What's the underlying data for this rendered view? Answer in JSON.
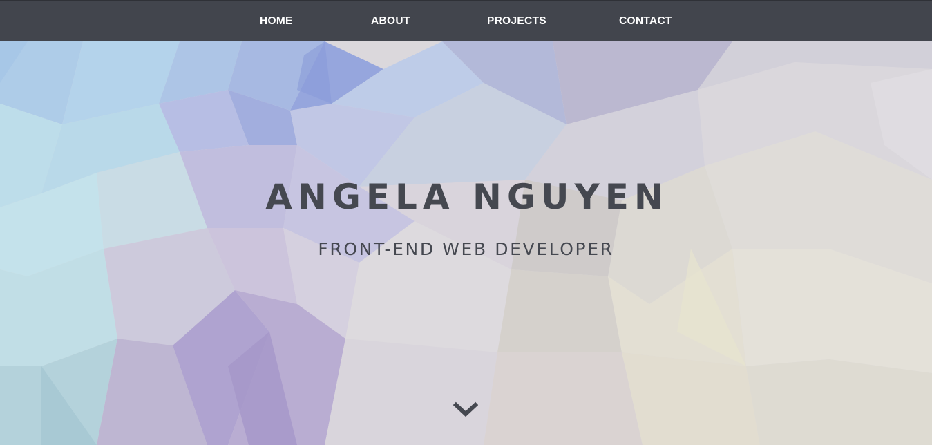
{
  "nav": {
    "items": [
      {
        "label": "HOME"
      },
      {
        "label": "ABOUT"
      },
      {
        "label": "PROJECTS"
      },
      {
        "label": "CONTACT"
      }
    ]
  },
  "hero": {
    "name": "ANGELA NGUYEN",
    "tagline": "FRONT-END WEB DEVELOPER",
    "scroll_icon": "chevron-down-icon"
  },
  "colors": {
    "navbar": "#42454d",
    "nav_text": "#ffffff",
    "hero_text": "#454850"
  }
}
